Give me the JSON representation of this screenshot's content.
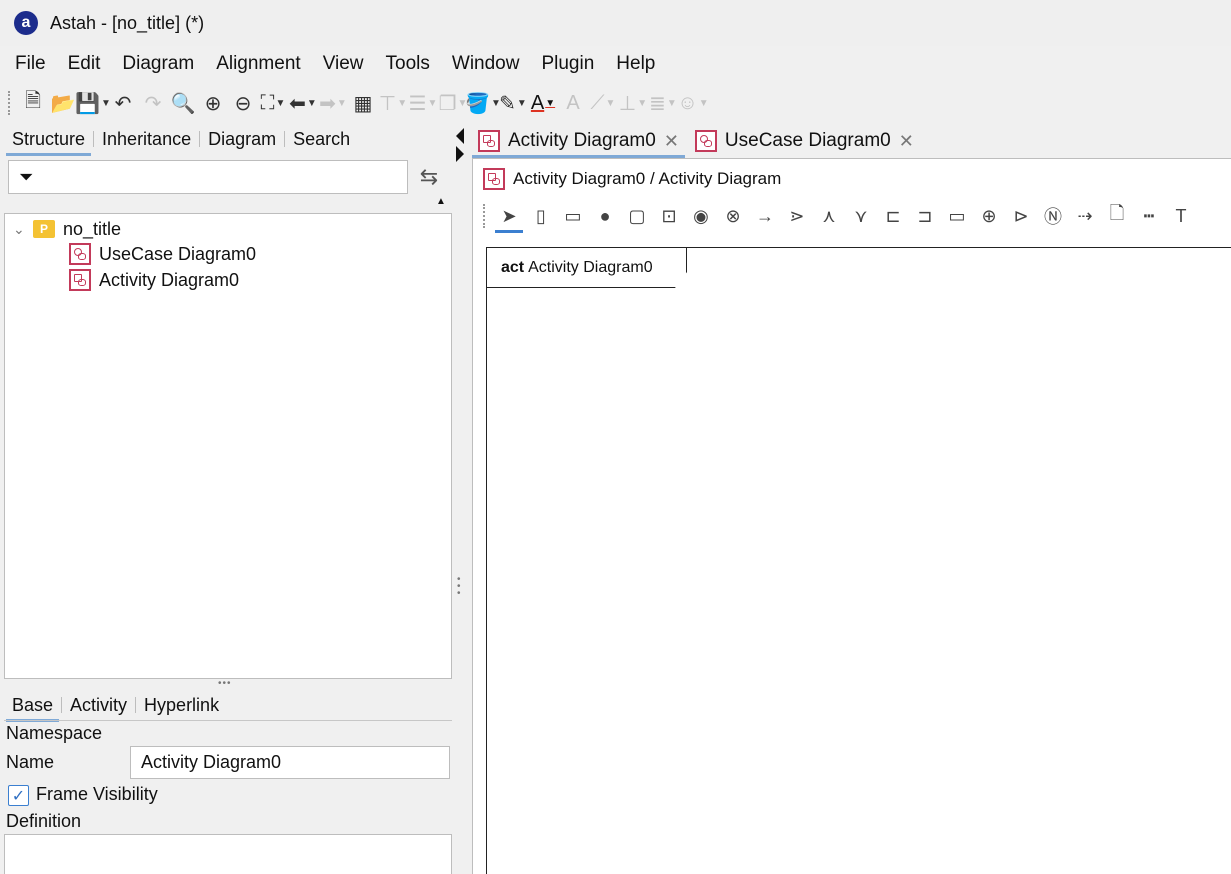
{
  "window": {
    "title": "Astah - [no_title] (*)",
    "logo": "a"
  },
  "menu": [
    "File",
    "Edit",
    "Diagram",
    "Alignment",
    "View",
    "Tools",
    "Window",
    "Plugin",
    "Help"
  ],
  "toolbar_icons": [
    "new-file",
    "open-folder",
    "save",
    "undo",
    "redo",
    "zoom",
    "zoom-in",
    "zoom-out",
    "fit-to-window",
    "back",
    "forward",
    "layout",
    "align-top",
    "align-left",
    "arrange",
    "fill-color",
    "line-color",
    "font-color",
    "font-size",
    "line-style",
    "tree-layout",
    "list",
    "emoji"
  ],
  "left_tabs": {
    "structure": "Structure",
    "inheritance": "Inheritance",
    "diagram": "Diagram",
    "search": "Search"
  },
  "tree": {
    "root": "no_title",
    "root_icon_letter": "P",
    "children": [
      "UseCase Diagram0",
      "Activity Diagram0"
    ]
  },
  "props_tabs": {
    "base": "Base",
    "activity": "Activity",
    "hyperlink": "Hyperlink"
  },
  "props": {
    "namespace_label": "Namespace",
    "name_label": "Name",
    "name_value": "Activity Diagram0",
    "frame_visibility_label": "Frame Visibility",
    "frame_visibility_checked": true,
    "definition_label": "Definition"
  },
  "editor_tabs": [
    "Activity Diagram0",
    "UseCase Diagram0"
  ],
  "breadcrumb": "Activity Diagram0 / Activity Diagram",
  "palette_icons": [
    "select",
    "partition-vertical",
    "partition-horizontal",
    "initial-node",
    "action",
    "call-behavior",
    "final-node",
    "flow-final",
    "control-flow",
    "fork",
    "join",
    "merge",
    "input-pin",
    "output-pin",
    "object-node",
    "connector",
    "send-signal",
    "note-n",
    "dependency",
    "note",
    "dashed-line",
    "text"
  ],
  "frame": {
    "keyword": "act",
    "name": "Activity Diagram0"
  },
  "colors": {
    "tab_underline": "#7fa9d6",
    "diagram_icon": "#c33a5a",
    "package_icon": "#f4c233",
    "logo_bg": "#1c2c8c"
  }
}
